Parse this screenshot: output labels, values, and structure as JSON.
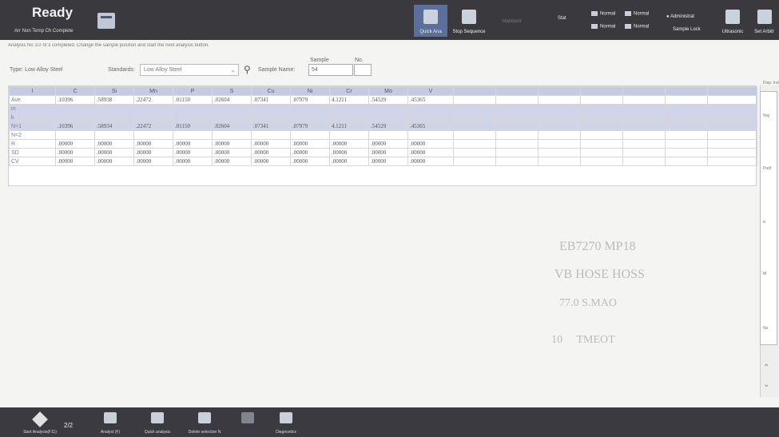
{
  "toolbar": {
    "status": "Ready",
    "status_line": "Arr Non   Temp Ch Complete",
    "btn_quick_analysis": "Quick Ana",
    "btn_stop_sequence": "Stop Sequence",
    "btn_faded": "Standard",
    "btn_stat": "Stat",
    "normal_1": "Normal",
    "normal_2": "Normal",
    "normal_3": "Normal",
    "normal_4": "Normal",
    "user": "Administrat",
    "user_sub": "Sample Lock",
    "btn_manual": "Ultrasonic",
    "btn_settings": "Set Arbitr"
  },
  "info_text": "Analysis No 1/2 of 3 completed. Change the sample position and start the next analysis button.",
  "filters": {
    "type_label": "Type:",
    "type_value": "Low Alloy Steel",
    "standards_label": "Standards:",
    "standards_value": "Low Alloy Steel",
    "sample_name_label": "Sample Name:",
    "sample_name_value": "54",
    "sample_header": "Sample",
    "no_header": "No."
  },
  "table": {
    "headers": [
      "I",
      "C",
      "Si",
      "Mn",
      "P",
      "S",
      "Cu",
      "Ni",
      "Cr",
      "Mo",
      "V",
      "",
      "",
      "",
      "",
      "",
      "",
      ""
    ],
    "rows": [
      {
        "label": "Ave",
        "values": [
          ".10396",
          ".58938",
          ".22472",
          ".01150",
          ".02604",
          ".07341",
          ".07979",
          "4.1211",
          ".54529",
          ".45365"
        ],
        "band": false
      },
      {
        "label": "m",
        "values": [
          "",
          "",
          "",
          "",
          "",
          "",
          "",
          "",
          "",
          ""
        ],
        "band": true
      },
      {
        "label": "k",
        "values": [
          "",
          "",
          "",
          "",
          "",
          "",
          "",
          "",
          "",
          ""
        ],
        "band": true
      },
      {
        "label": "N=1",
        "values": [
          ".10396",
          ".58934",
          ".22472",
          ".01150",
          ".02604",
          ".07341",
          ".07979",
          "4.1211",
          ".54529",
          ".45365"
        ],
        "band": true
      },
      {
        "label": "N<2",
        "values": [
          "",
          "",
          "",
          "",
          "",
          "",
          "",
          "",
          "",
          ""
        ],
        "band": false
      },
      {
        "label": "R",
        "values": [
          ".00000",
          ".00000",
          ".00000",
          ".00000",
          ".00000",
          ".00000",
          ".00000",
          ".00000",
          ".00000",
          ".00000"
        ],
        "band": false
      },
      {
        "label": "SD",
        "values": [
          ".00000",
          ".00000",
          ".00000",
          ".00000",
          ".00000",
          ".00000",
          ".00000",
          ".00000",
          ".00000",
          ".00000"
        ],
        "band": false
      },
      {
        "label": "CV",
        "values": [
          ".00000",
          ".00000",
          ".00000",
          ".00000",
          ".00000",
          ".00000",
          ".00000",
          ".00000",
          ".00000",
          ".00000"
        ],
        "band": false
      }
    ]
  },
  "right_panel": {
    "title": "Disp. Ind",
    "labels": [
      "Nrg",
      "Purif",
      "a",
      "M",
      "No"
    ]
  },
  "taskbar": {
    "item_1": "Start Analysis(F11)",
    "page": "2/2",
    "item_2": "Analyst (F)",
    "item_3": "Quick analysis",
    "item_4": "Delete selection N",
    "item_5": "",
    "item_6": "Diagnostics"
  }
}
